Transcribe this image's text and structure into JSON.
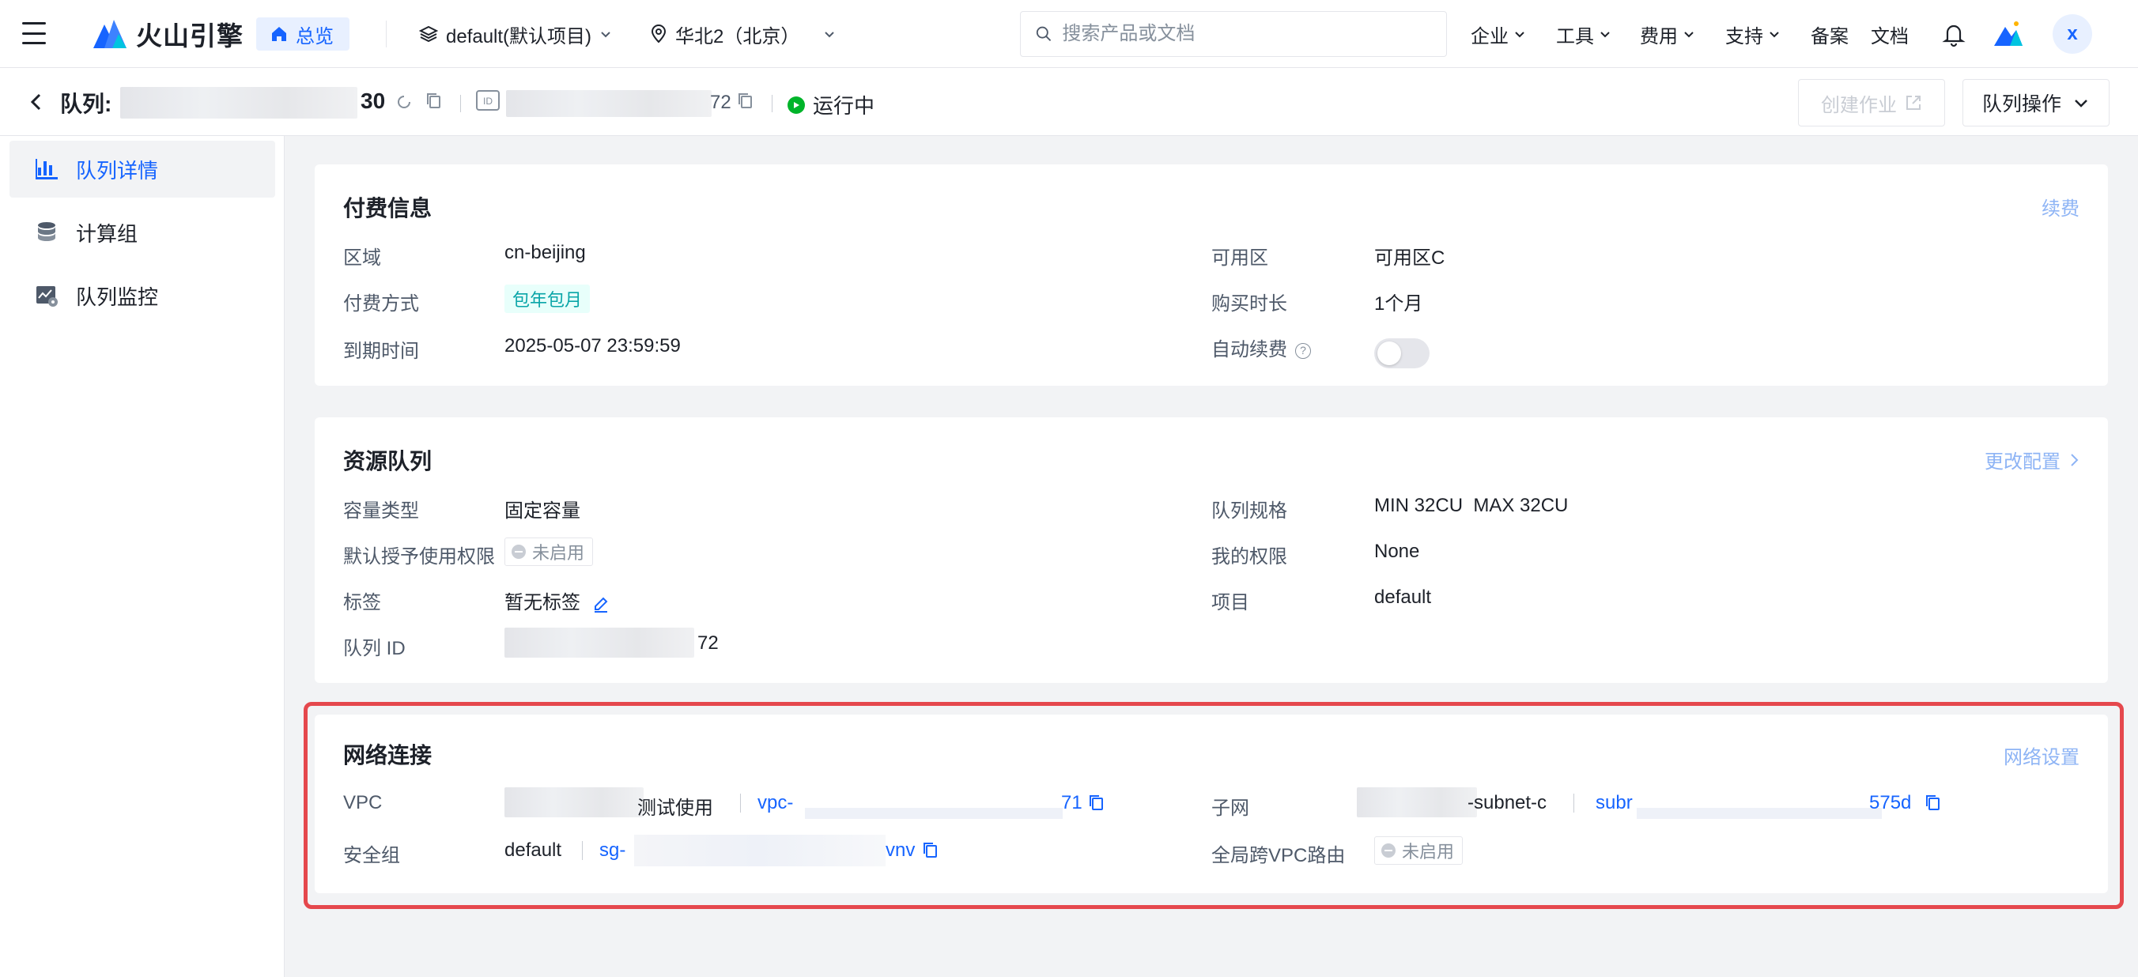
{
  "topbar": {
    "logo_text": "火山引擎",
    "overview": "总览",
    "project": "default(默认项目)",
    "region": "华北2（北京）",
    "search_placeholder": "搜索产品或文档",
    "menus": [
      "企业",
      "工具",
      "费用",
      "支持"
    ],
    "filing": "备案",
    "docs": "文档",
    "avatar": "x",
    "brand_color": "#1664ff"
  },
  "header": {
    "title": "队列:",
    "name_suffix": "30",
    "id_badge": "ID",
    "id_suffix": "72",
    "status": "运行中",
    "create_job": "创建作业",
    "queue_ops": "队列操作"
  },
  "sidebar": {
    "items": [
      {
        "label": "队列详情",
        "icon": "chart-icon",
        "active": true
      },
      {
        "label": "计算组",
        "icon": "database-icon",
        "active": false
      },
      {
        "label": "队列监控",
        "icon": "monitor-icon",
        "active": false
      }
    ]
  },
  "billing": {
    "title": "付费信息",
    "action": "续费",
    "region_label": "区域",
    "region_value": "cn-beijing",
    "pay_label": "付费方式",
    "pay_value": "包年包月",
    "expire_label": "到期时间",
    "expire_value": "2025-05-07 23:59:59",
    "zone_label": "可用区",
    "zone_value": "可用区C",
    "duration_label": "购买时长",
    "duration_value": "1个月",
    "renew_label": "自动续费",
    "renew_help": "?",
    "renew_enabled": false
  },
  "resource": {
    "title": "资源队列",
    "action": "更改配置",
    "capacity_label": "容量类型",
    "capacity_value": "固定容量",
    "grant_label": "默认授予使用权限",
    "grant_value": "未启用",
    "tag_label": "标签",
    "tag_value": "暂无标签",
    "queueid_label": "队列 ID",
    "queueid_suffix": "72",
    "spec_label": "队列规格",
    "spec_value": "MIN 32CU  MAX 32CU",
    "perm_label": "我的权限",
    "perm_value": "None",
    "project_label": "项目",
    "project_value": "default"
  },
  "network": {
    "title": "网络连接",
    "action": "网络设置",
    "vpc_label": "VPC",
    "vpc_name_suffix": "测试使用",
    "vpc_id_prefix": "vpc-",
    "vpc_id_suffix": "71",
    "subnet_label": "子网",
    "subnet_name_suffix": "-subnet-c",
    "subnet_id_prefix": "subr",
    "subnet_id_suffix": "575d",
    "sg_label": "安全组",
    "sg_name": "default",
    "sg_id_prefix": "sg-",
    "sg_id_suffix": "vnv",
    "route_label": "全局跨VPC路由",
    "route_value": "未启用",
    "highlight_color": "#e5484d"
  }
}
